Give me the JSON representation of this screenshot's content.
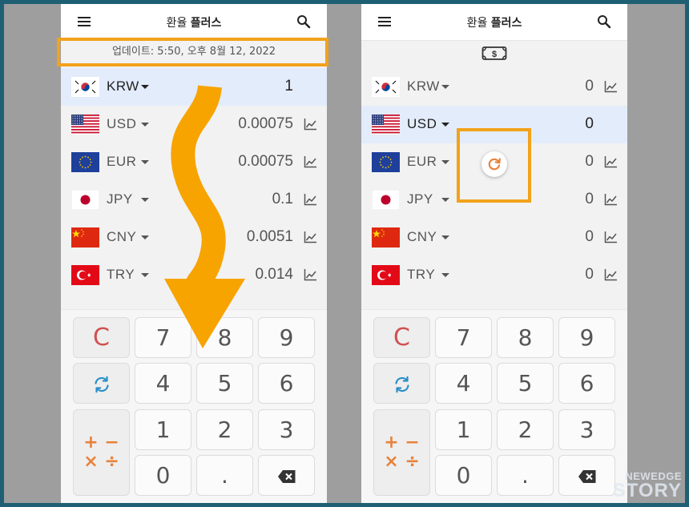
{
  "app": {
    "title_prefix": "환율",
    "title_bold": "플러스"
  },
  "left": {
    "update_text": "업데이트: 5:50, 오후 8월 12, 2022",
    "rows": [
      {
        "code": "KRW",
        "flag": "kr-flag",
        "value": "1",
        "active": true,
        "chart": false
      },
      {
        "code": "USD",
        "flag": "us-flag",
        "value": "0.00075",
        "active": false,
        "chart": true
      },
      {
        "code": "EUR",
        "flag": "eu-flag",
        "value": "0.00075",
        "active": false,
        "chart": true
      },
      {
        "code": "JPY",
        "flag": "jp-flag",
        "value": "0.1",
        "active": false,
        "chart": true
      },
      {
        "code": "CNY",
        "flag": "cn-flag",
        "value": "0.0051",
        "active": false,
        "chart": true
      },
      {
        "code": "TRY",
        "flag": "tr-flag",
        "value": "0.014",
        "active": false,
        "chart": true
      }
    ]
  },
  "right": {
    "rows": [
      {
        "code": "KRW",
        "flag": "kr-flag",
        "value": "0",
        "active": false,
        "chart": true
      },
      {
        "code": "USD",
        "flag": "us-flag",
        "value": "0",
        "active": true,
        "chart": false
      },
      {
        "code": "EUR",
        "flag": "eu-flag",
        "value": "0",
        "active": false,
        "chart": true
      },
      {
        "code": "JPY",
        "flag": "jp-flag",
        "value": "0",
        "active": false,
        "chart": true
      },
      {
        "code": "CNY",
        "flag": "cn-flag",
        "value": "0",
        "active": false,
        "chart": true
      },
      {
        "code": "TRY",
        "flag": "tr-flag",
        "value": "0",
        "active": false,
        "chart": true
      }
    ]
  },
  "keypad": {
    "clear": "C",
    "digits": [
      "7",
      "8",
      "9",
      "4",
      "5",
      "6",
      "1",
      "2",
      "3",
      "0"
    ],
    "dot": ".",
    "calc": "+ −\n× ÷"
  },
  "icons": {
    "menu": "menu-icon",
    "search": "search-icon",
    "trend": "line-chart-icon",
    "refresh": "refresh-icon",
    "backspace": "backspace-icon",
    "money": "money-icon"
  },
  "colors": {
    "accent": "#f2a21b",
    "active_row": "#e3ecfb",
    "clear": "#d05050",
    "calc": "#e8823a",
    "refresh": "#2b8fc7",
    "frame": "#1f5f74"
  },
  "watermark": {
    "line1": "NEWEDGE",
    "line2": "STORY"
  }
}
